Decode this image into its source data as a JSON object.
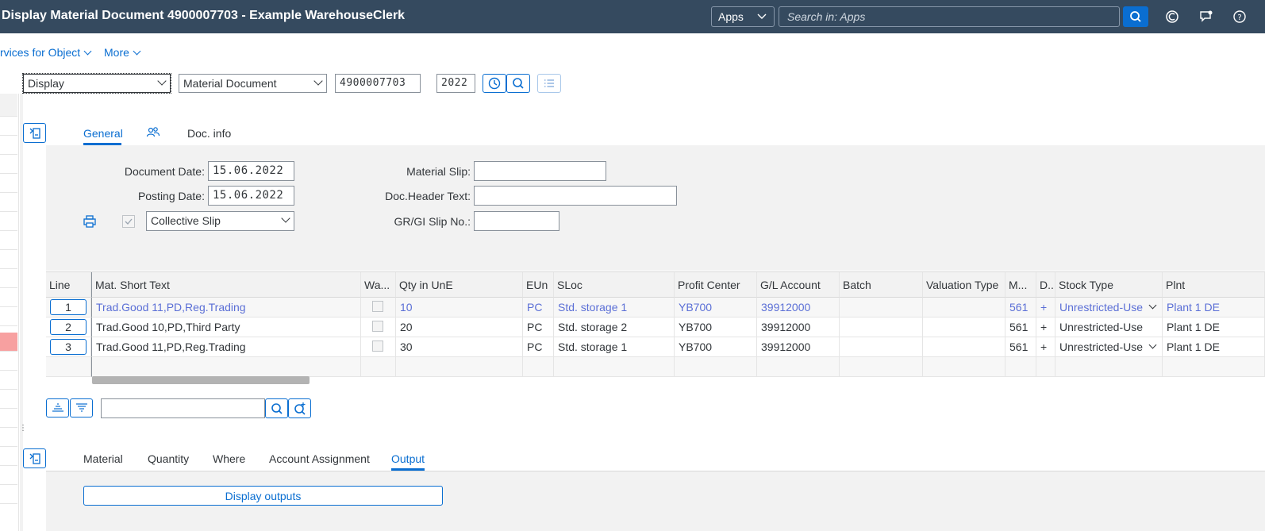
{
  "shell": {
    "title": "Display Material Document 4900007703 - Example WarehouseClerk",
    "apps_label": "Apps",
    "search_placeholder": "Search in: Apps"
  },
  "menu": {
    "services": "rvices for Object",
    "more": "More"
  },
  "selection": {
    "action": "Display",
    "object": "Material Document",
    "doc_number": "4900007703",
    "year": "2022"
  },
  "header_tabs": [
    "General",
    "Doc. info"
  ],
  "general": {
    "document_date_label": "Document Date:",
    "document_date": "15.06.2022",
    "posting_date_label": "Posting Date:",
    "posting_date": "15.06.2022",
    "slip_type": "Collective Slip",
    "material_slip_label": "Material Slip:",
    "doc_header_text_label": "Doc.Header Text:",
    "gr_gi_slip_label": "GR/GI Slip No.:"
  },
  "table": {
    "columns": [
      "Line",
      "Mat. Short Text",
      "Wa...",
      "Qty in UnE",
      "EUn",
      "SLoc",
      "Profit Center",
      "G/L Account",
      "Batch",
      "Valuation Type",
      "M...",
      "D..",
      "Stock Type",
      "Plnt"
    ],
    "rows": [
      {
        "line": "1",
        "text": "Trad.Good 11,PD,Reg.Trading",
        "qty": "10",
        "eun": "PC",
        "sloc": "Std. storage 1",
        "pc": "YB700",
        "gl": "39912000",
        "m": "561",
        "d": "+",
        "stock": "Unrestricted-Use",
        "plnt": "Plant 1 DE"
      },
      {
        "line": "2",
        "text": "Trad.Good 10,PD,Third Party",
        "qty": "20",
        "eun": "PC",
        "sloc": "Std. storage 2",
        "pc": "YB700",
        "gl": "39912000",
        "m": "561",
        "d": "+",
        "stock": "Unrestricted-Use",
        "plnt": "Plant 1 DE"
      },
      {
        "line": "3",
        "text": "Trad.Good 11,PD,Reg.Trading",
        "qty": "30",
        "eun": "PC",
        "sloc": "Std. storage 1",
        "pc": "YB700",
        "gl": "39912000",
        "m": "561",
        "d": "+",
        "stock": "Unrestricted-Use",
        "plnt": "Plant 1 DE"
      }
    ]
  },
  "item_tabs": [
    "Material",
    "Quantity",
    "Where",
    "Account Assignment",
    "Output"
  ],
  "output": {
    "button": "Display outputs"
  },
  "colors": {
    "shell_bg": "#354a5f",
    "accent": "#0a6ed1",
    "link_row": "#5b6fd6"
  }
}
